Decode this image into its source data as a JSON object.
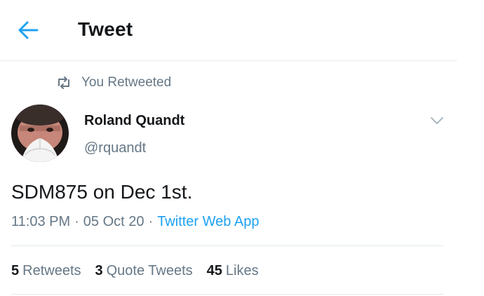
{
  "header": {
    "title": "Tweet",
    "back_icon": "arrow-left-icon"
  },
  "retweet_context": {
    "icon": "retweet-icon",
    "label": "You Retweeted"
  },
  "tweet": {
    "author": {
      "name": "Roland Quandt",
      "handle": "@rquandt"
    },
    "more_icon": "chevron-down-icon",
    "text": "SDM875 on Dec 1st.",
    "time": "11:03 PM",
    "date": "05 Oct 20",
    "separator": "·",
    "source": "Twitter Web App",
    "stats": {
      "retweets_count": "5",
      "retweets_label": "Retweets",
      "quotes_count": "3",
      "quotes_label": "Quote Tweets",
      "likes_count": "45",
      "likes_label": "Likes"
    }
  },
  "colors": {
    "accent": "#1da1f2",
    "text_primary": "#14171a",
    "text_secondary": "#657786",
    "divider": "#e1e8ed"
  }
}
